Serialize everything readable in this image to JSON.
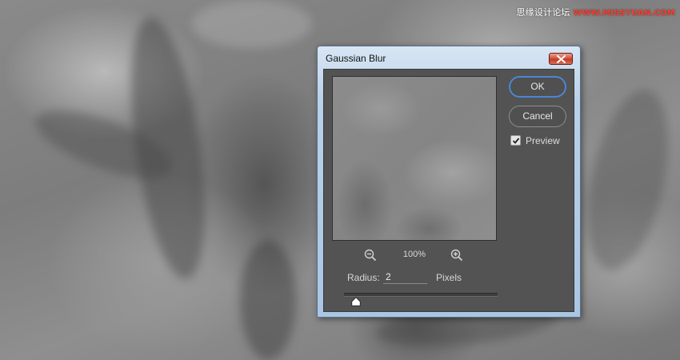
{
  "watermark": {
    "text": "思缘设计论坛",
    "url": "WWW.MISSYUAN.COM"
  },
  "dialog": {
    "title": "Gaussian Blur",
    "zoom_level": "100%",
    "radius_label": "Radius:",
    "radius_value": "2",
    "unit_label": "Pixels",
    "radius_slider_fraction": 0.08,
    "ok_label": "OK",
    "cancel_label": "Cancel",
    "preview_label": "Preview",
    "preview_checked": true
  },
  "colors": {
    "ok_focus_ring": "#4a86d6",
    "close_button": "#c23a24",
    "client_background": "#535353"
  },
  "icons": {
    "close": "close-icon",
    "zoom_out": "zoom-out-icon",
    "zoom_in": "zoom-in-icon",
    "checkbox": "checkmark-icon",
    "slider": "slider-thumb"
  }
}
